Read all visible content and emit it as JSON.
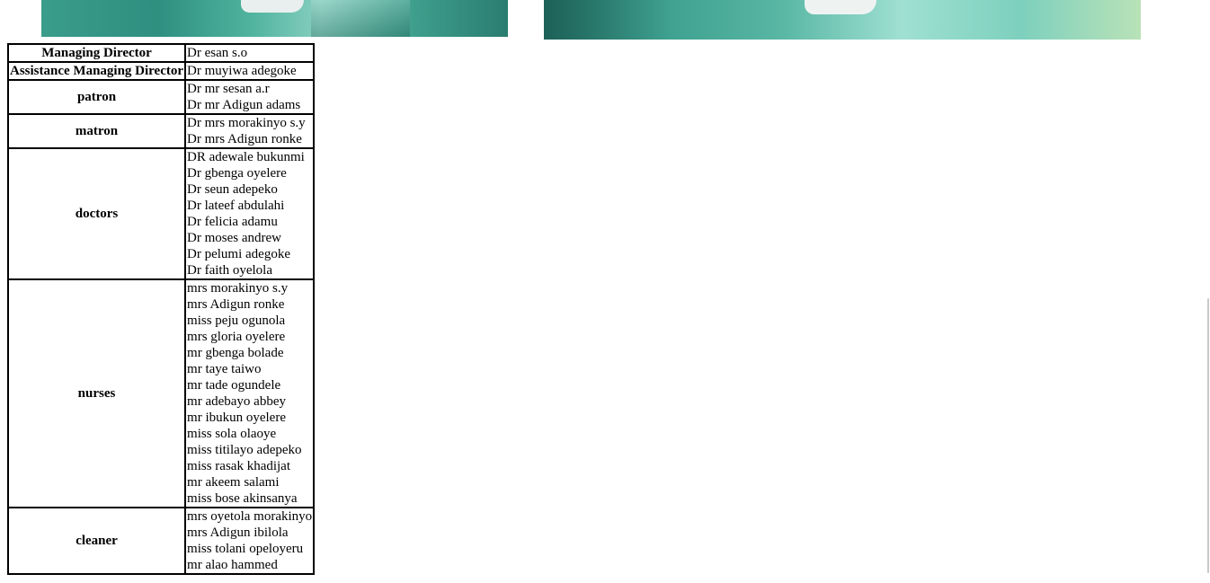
{
  "images": {
    "left_photo": "surgeons-in-scrubs-photo",
    "right_photo": "operating-room-photo"
  },
  "staff_table": {
    "rows": [
      {
        "role": "Managing Director",
        "names": [
          "Dr esan s.o"
        ]
      },
      {
        "role": "Assistance Managing Director",
        "names": [
          "Dr muyiwa adegoke"
        ]
      },
      {
        "role": "patron",
        "names": [
          "Dr mr sesan a.r",
          "Dr mr Adigun adams"
        ]
      },
      {
        "role": "matron",
        "names": [
          "Dr mrs morakinyo s.y",
          "Dr mrs Adigun ronke"
        ]
      },
      {
        "role": "doctors",
        "names": [
          "DR adewale bukunmi",
          "Dr gbenga oyelere",
          "Dr seun adepeko",
          "Dr lateef abdulahi",
          "Dr felicia adamu",
          "Dr moses andrew",
          "Dr pelumi adegoke",
          "Dr faith oyelola"
        ]
      },
      {
        "role": "nurses",
        "names": [
          "mrs morakinyo s.y",
          "mrs Adigun ronke",
          "miss peju ogunola",
          "mrs gloria oyelere",
          "mr gbenga bolade",
          "mr taye taiwo",
          "mr tade ogundele",
          "mr adebayo abbey",
          "mr ibukun oyelere",
          "miss sola olaoye",
          "miss titilayo adepeko",
          "miss rasak khadijat",
          "mr akeem salami",
          "miss bose akinsanya"
        ]
      },
      {
        "role": "cleaner",
        "names": [
          "mrs oyetola morakinyo",
          "mrs Adigun ibilola",
          "miss tolani opeloyeru",
          "mr alao hammed"
        ]
      }
    ]
  }
}
